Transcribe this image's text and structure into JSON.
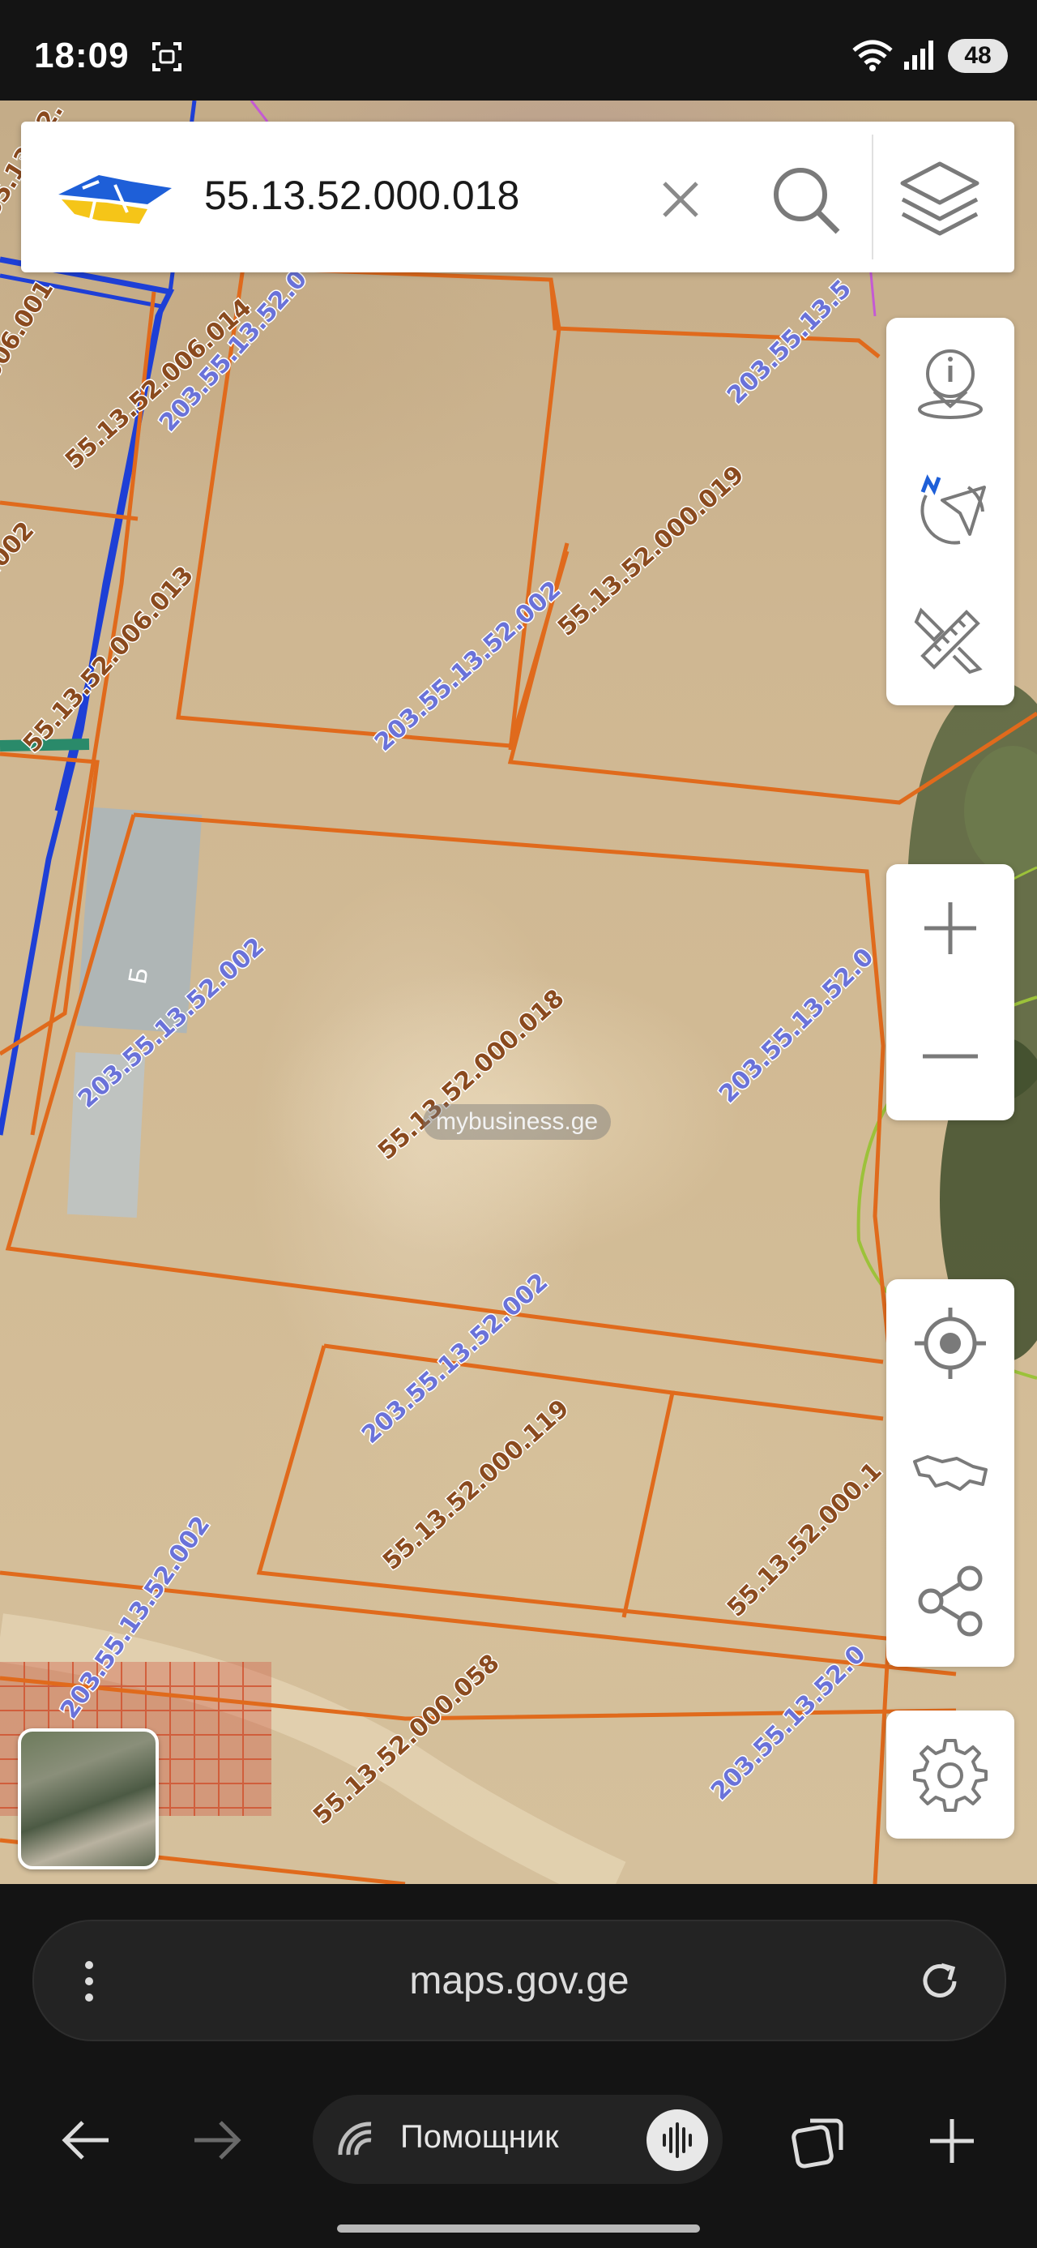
{
  "status_bar": {
    "time": "18:09",
    "battery": "48"
  },
  "search": {
    "query": "55.13.52.000.018"
  },
  "map": {
    "watermark": "mybusiness.ge",
    "building_label": "Б",
    "parcel_labels": [
      "55.13.52.006.014",
      "55.13.52.006.013",
      "55.13.52.000.019",
      "55.13.52.000.018",
      "55.13.52.000.119",
      "55.13.52.000.1",
      "55.13.52.000.058",
      "006.001",
      ".002",
      "55.13.52."
    ],
    "cadastral_labels": [
      "203.55.13.52.0",
      "203.55.13.52.002",
      "203.55.13.52.002",
      "203.55.13.52.0",
      "203.55.13.52.002",
      "203.55.13.52.0",
      "203.55.13.52.002",
      "203.55.13.5"
    ],
    "colors": {
      "parcel_line": "#e06a1c",
      "road_line": "#1e3fd6",
      "cadastral_text": "#6a72d9",
      "parcel_text": "#8a4a1e"
    }
  },
  "browser": {
    "url": "maps.gov.ge",
    "assistant_label": "Помощник"
  },
  "icons": {
    "right_panel_top": [
      "info-location-icon",
      "compass-navigate-icon",
      "measure-ruler-icon"
    ],
    "zoom": [
      "zoom-in-icon",
      "zoom-out-icon"
    ],
    "right_panel_bottom": [
      "my-location-icon",
      "georgia-map-icon",
      "share-icon"
    ],
    "settings": "gear-icon"
  }
}
